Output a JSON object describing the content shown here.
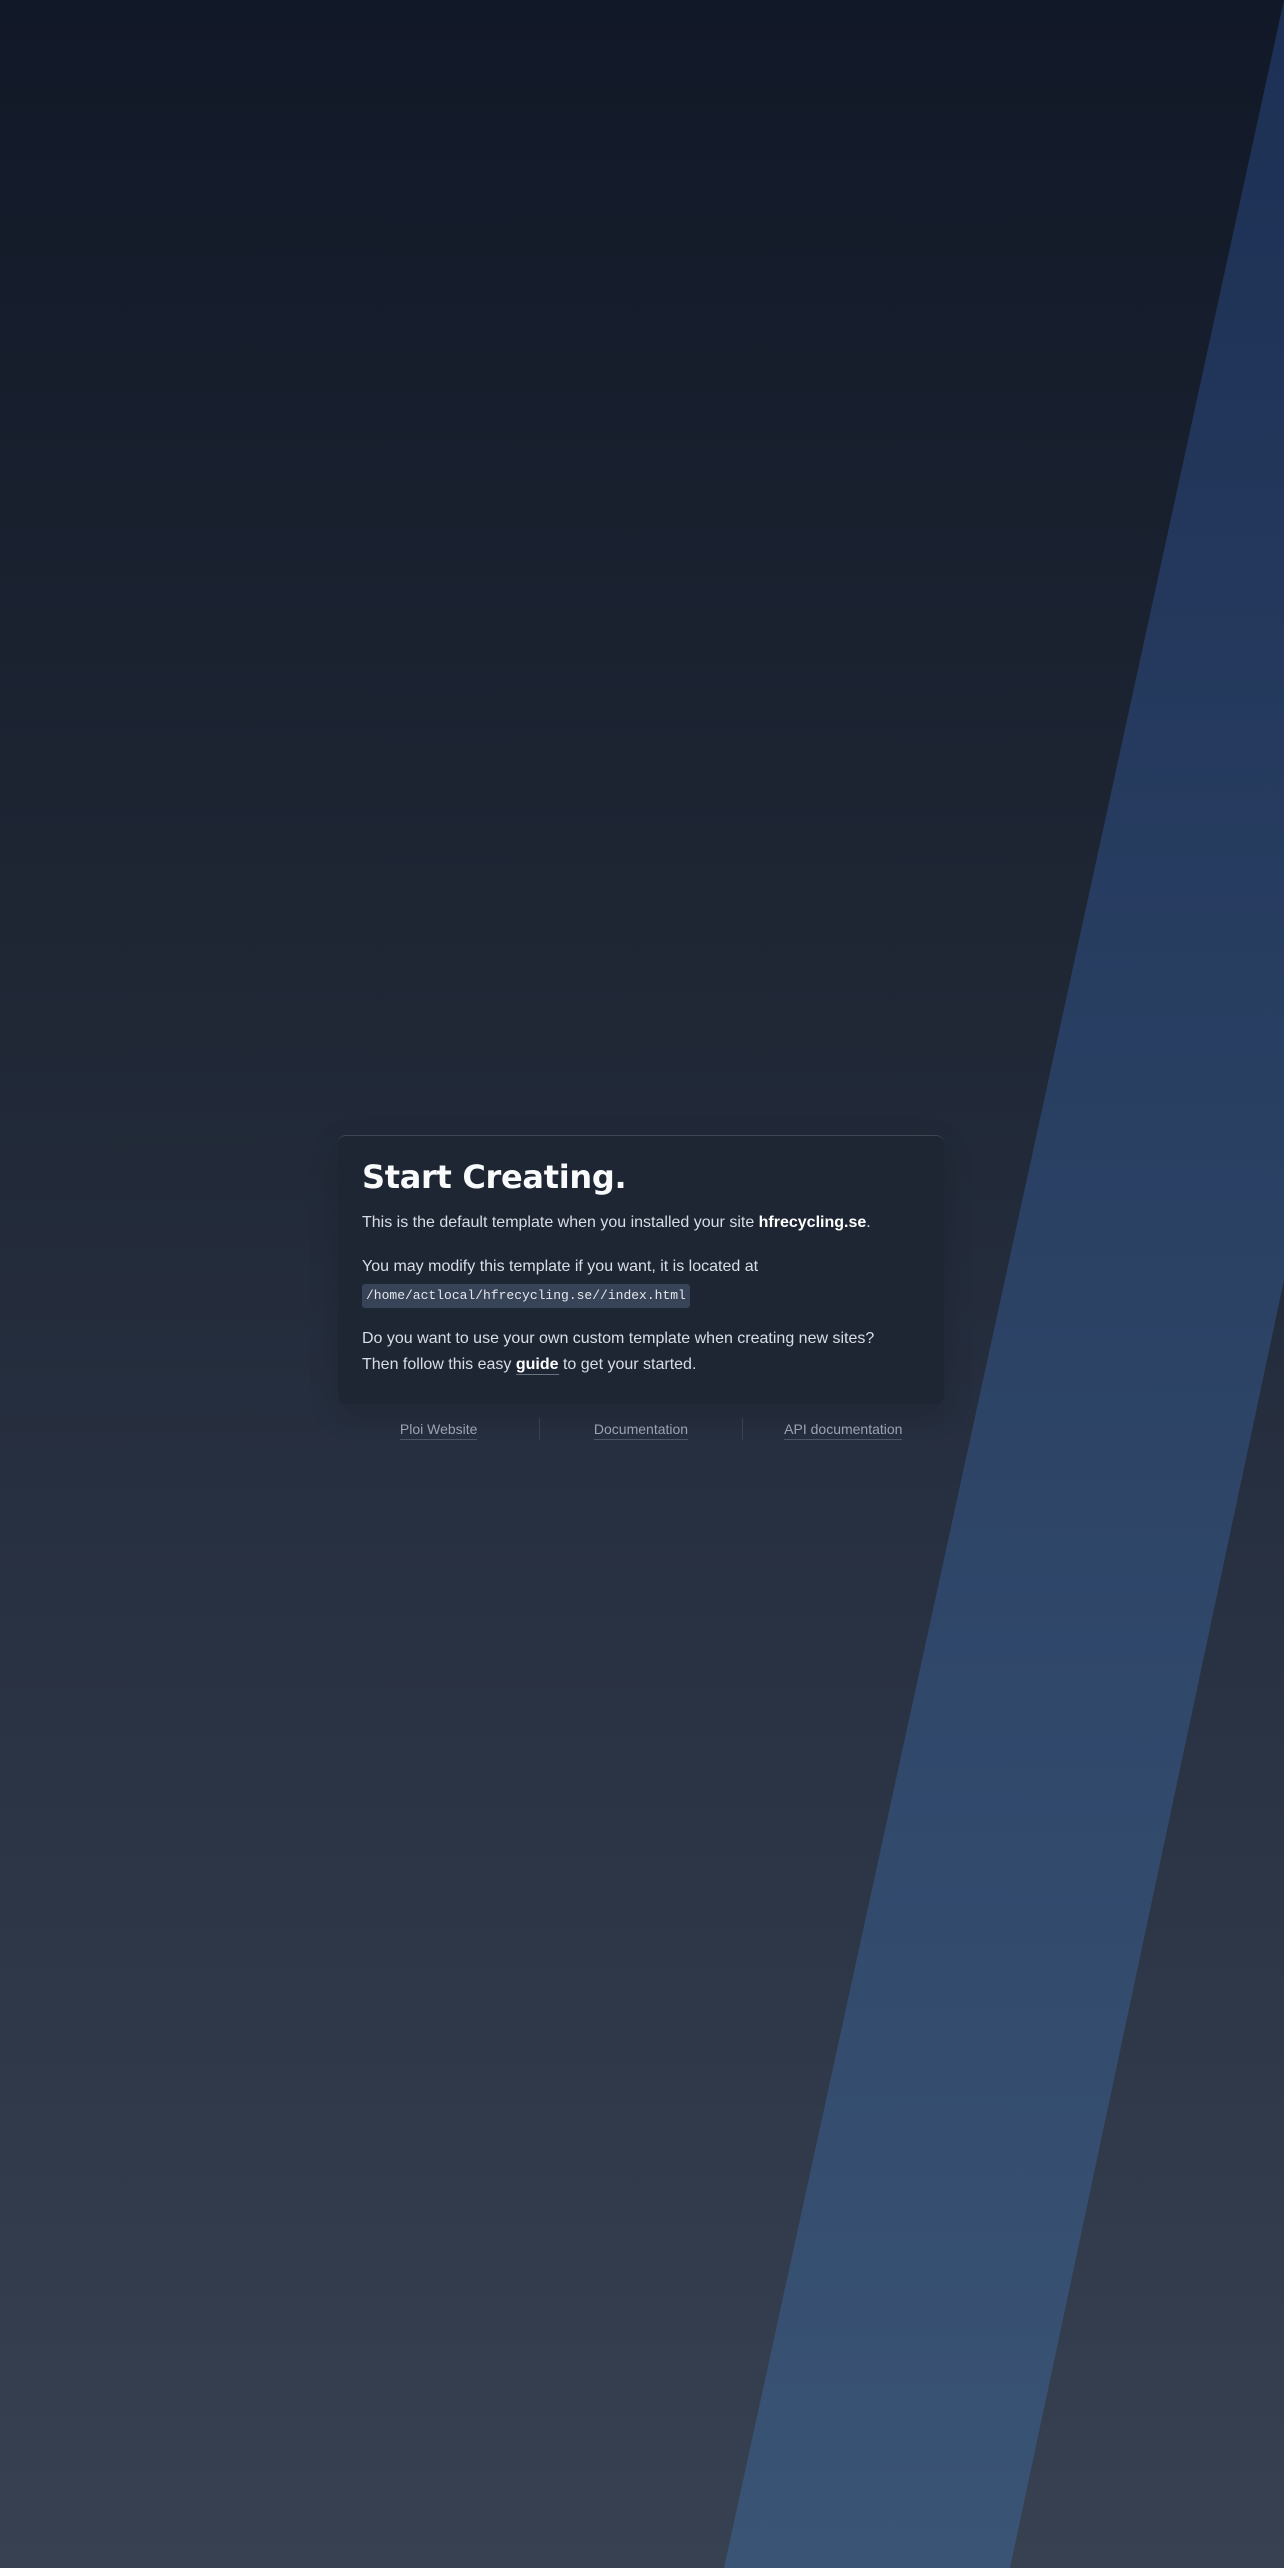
{
  "card": {
    "title": "Start Creating.",
    "intro_text": "This is the default template when you installed your site ",
    "site_name": "hfrecycling.se",
    "intro_suffix": ".",
    "modify_text": "You may modify this template if you want, it is located at",
    "template_path": "/home/actlocal/hfrecycling.se//index.html",
    "custom_line": "Do you want to use your own custom template when creating new sites?",
    "guide_prefix": "Then follow this easy ",
    "guide_label": "guide",
    "guide_suffix": " to get your started."
  },
  "footer": {
    "links": [
      {
        "label": "Ploi Website"
      },
      {
        "label": "Documentation"
      },
      {
        "label": "API documentation"
      }
    ]
  },
  "colors": {
    "background_top": "#111827",
    "background_bottom": "#374151",
    "stripe_top": "#1d3157",
    "stripe_bottom": "#3a5577",
    "card": "#1f2633"
  }
}
